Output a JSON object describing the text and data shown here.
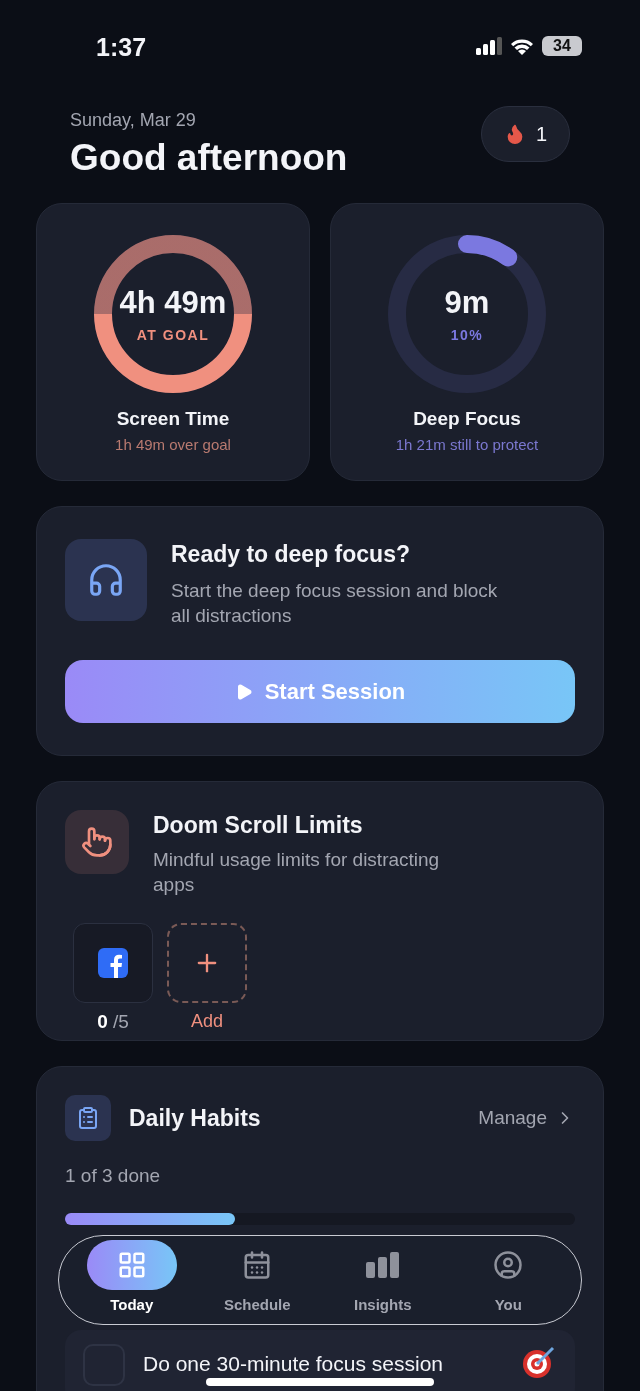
{
  "status_bar": {
    "time": "1:37",
    "battery": "34"
  },
  "header": {
    "date": "Sunday, Mar 29",
    "greeting": "Good afternoon",
    "streak": "1"
  },
  "stats": [
    {
      "value": "4h 49m",
      "status": "AT GOAL",
      "title": "Screen Time",
      "subtitle": "1h 49m over goal",
      "level": 1,
      "color": "#f0907f"
    },
    {
      "value": "9m",
      "status": "10%",
      "title": "Deep Focus",
      "subtitle": "1h 21m still to protect",
      "level": 0.1,
      "color": "#7b78e0"
    }
  ],
  "focus_card": {
    "title": "Ready to deep focus?",
    "description": "Start the deep focus session and block all distractions",
    "button": "Start Session"
  },
  "doom_scroll": {
    "title": "Doom Scroll Limits",
    "subtitle": "Mindful usage limits for distracting apps",
    "apps": [
      {
        "count": "0",
        "limit": "/5"
      }
    ],
    "add_label": "Add"
  },
  "habits": {
    "title": "Daily Habits",
    "manage": "Manage",
    "progress_text": "1 of 3 done",
    "level": 0.333,
    "items": [
      {
        "label": "Do one 30-minute focus session",
        "checked": false
      }
    ]
  },
  "tabs": [
    {
      "label": "Today",
      "selected": true
    },
    {
      "label": "Schedule",
      "selected": false
    },
    {
      "label": "Insights",
      "selected": false
    },
    {
      "label": "You",
      "selected": false
    }
  ]
}
